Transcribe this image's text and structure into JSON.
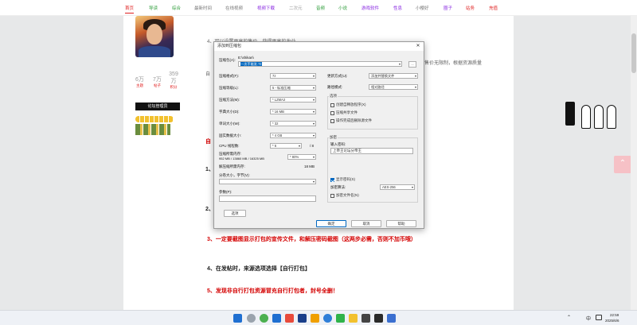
{
  "nav": {
    "items": [
      "首页",
      "导读",
      "综合",
      "最新时间",
      "在线视频",
      "视频下载",
      "二次元",
      "音频",
      "小说",
      "游戏软件",
      "性息",
      "小樱好",
      "圈子",
      "站务",
      "充值"
    ],
    "colors": [
      "#e02020",
      "#2e9d3a",
      "#2e9d3a",
      "#777777",
      "#777777",
      "#8a2be2",
      "#999999",
      "#2e9d3a",
      "#2e9d3a",
      "#8a2be2",
      "#8a2be2",
      "#777777",
      "#8a2be2",
      "#e02020",
      "#e02020"
    ]
  },
  "profile": {
    "stats": [
      {
        "value": "6万",
        "label": "主题"
      },
      {
        "value": "7万",
        "label": "帖子"
      },
      {
        "value": "359万",
        "label": "积分"
      }
    ],
    "badge": "论坛管理员"
  },
  "article": {
    "line_top": "4、可以设置更高的售价，获得更高的收益",
    "line_right": "售价无限制，根据资源质量",
    "line3": "3、一定要截图显示打包的宣传文件，和解压密码截图（这两步必需，否则不加币哦）",
    "line4": "4、在发帖时，来源选项选择【自行打包】",
    "line5_prefix": "5、发现非自行打包资源冒充自行打包者，",
    "line5_suffix": "封号全删！",
    "left_fragments": [
      "自",
      "自",
      "1、",
      "2、"
    ]
  },
  "dialog": {
    "title": "添加到压缩包",
    "close": "✕",
    "archive_label": "压缩包(A):",
    "archive_path": "E:\\shikan\\",
    "archive_name": "一次不能发.7z",
    "browse": "...",
    "format_label": "压缩格式(F):",
    "format_value": "7z",
    "level_label": "压缩等级(L):",
    "level_value": "5 - 标准压缩",
    "method_label": "压缩方法(M):",
    "method_value": "* LZMA2",
    "dict_label": "字典大小(D):",
    "dict_value": "* 16 MB",
    "word_label": "单词大小(W):",
    "word_value": "* 32",
    "solid_label": "固实数据大小:",
    "solid_value": "* 4 GB",
    "cpu_label": "CPU 线程数:",
    "cpu_value": "* 6",
    "cpu_total": "/ 8",
    "mem_label": "压缩所需内存:",
    "mem_value": "952 MB / 13860 MB / 16325 MB",
    "mem_pct": "* 80%",
    "decomp_label": "解压缩所需内存:",
    "decomp_value": "18 MB",
    "split_label": "分卷大小，字节(V):",
    "params_label": "参数(P):",
    "options_button": "选项",
    "update_label": "更新方式(U):",
    "update_value": "添加并替换文件",
    "path_label": "路径模式:",
    "path_value": "相对路径",
    "options_group": "选项",
    "options": [
      {
        "label": "创建自释放程序(X)",
        "checked": false
      },
      {
        "label": "压缩共享文件",
        "checked": false
      },
      {
        "label": "操作完成后删除源文件",
        "checked": false
      }
    ],
    "encrypt_group": "加密",
    "password_label": "输入密码:",
    "password_value": "上帝王论坛分帝王",
    "show_password": "显示密码(S)",
    "method2_label": "加密算法:",
    "method2_value": "AES-256",
    "encrypt_names": "加密文件名(N)",
    "ok": "确定",
    "cancel": "取消",
    "help": "帮助"
  },
  "to_top": "⌃",
  "taskbar": {
    "tray_expand": "⌃",
    "lang": "中",
    "time": "22:59",
    "date": "2025/6/6",
    "icon_colors": [
      "#1f6fd1",
      "#9aa3ad",
      "#4cb050",
      "#1f6fd1",
      "#e84b3c",
      "#1a3f8a",
      "#f0a000",
      "#2f7fd8",
      "#2fb34a",
      "#f2c12e",
      "#444444",
      "#2a2a2a",
      "#3b6fd0"
    ]
  }
}
